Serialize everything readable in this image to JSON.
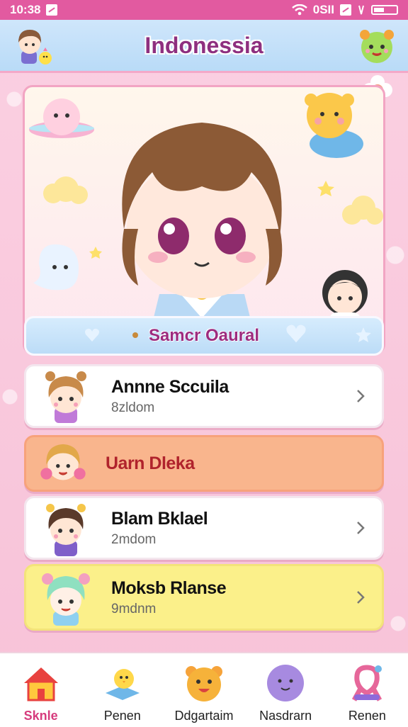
{
  "status_bar": {
    "time": "10:38",
    "network": "0SII"
  },
  "header": {
    "title": "Indonessia"
  },
  "hero": {
    "name": "Samcr Oaural"
  },
  "list": [
    {
      "name": "Annne Sccuila",
      "sub": "8zldom"
    },
    {
      "name": "Uarn Dleka",
      "sub": ""
    },
    {
      "name": "Blam Bklael",
      "sub": "2mdom"
    },
    {
      "name": "Moksb Rlanse",
      "sub": "9mdnm"
    }
  ],
  "tabs": [
    {
      "label": "Sknle",
      "icon": "home-icon"
    },
    {
      "label": "Penen",
      "icon": "chick-icon"
    },
    {
      "label": "Ddgartaim",
      "icon": "bear-icon"
    },
    {
      "label": "Nasdrarn",
      "icon": "blob-icon"
    },
    {
      "label": "Renen",
      "icon": "ribbon-icon"
    }
  ],
  "colors": {
    "status_bar": "#e25aa0",
    "header": "#c3e0f9",
    "title": "#8e2f7f",
    "item_highlight_orange": "#f9b58d",
    "item_highlight_yellow": "#fbf08a",
    "active_tab": "#d63b7d"
  }
}
